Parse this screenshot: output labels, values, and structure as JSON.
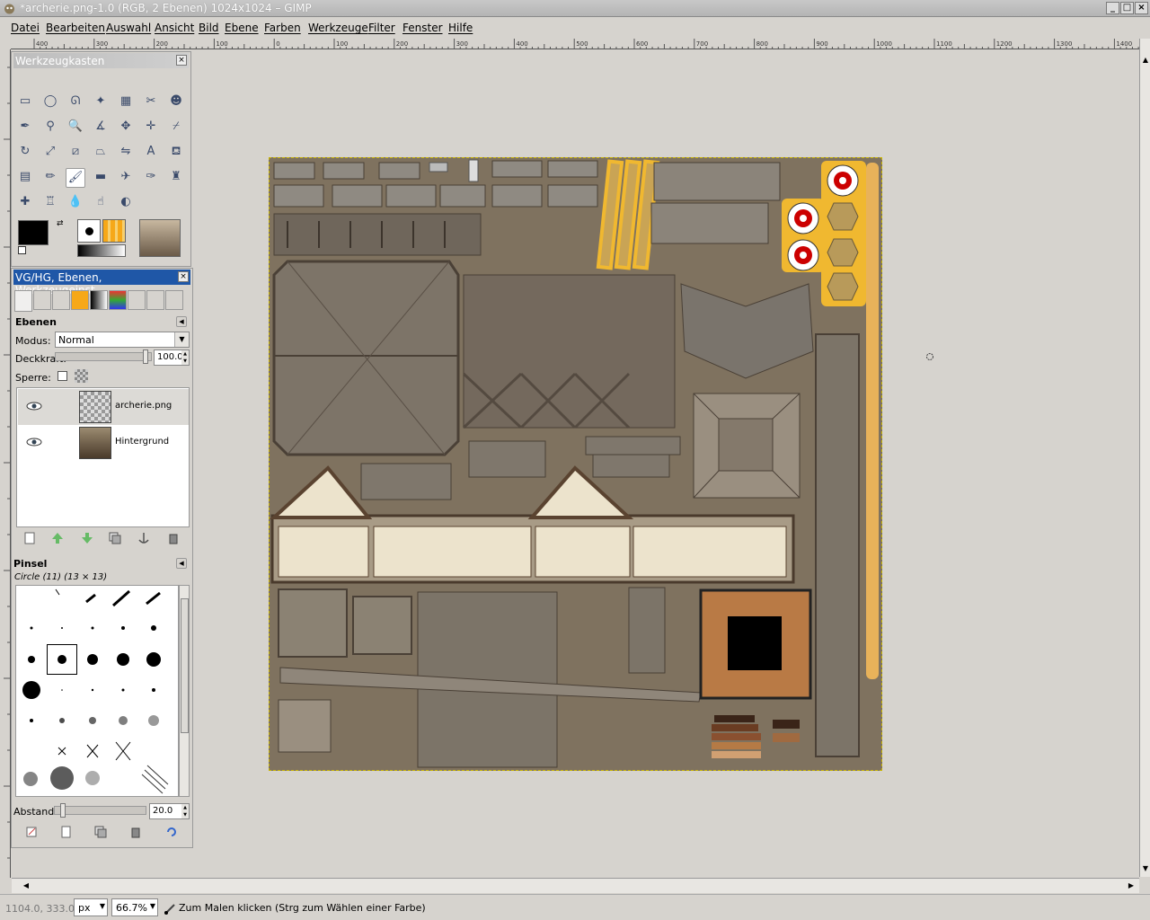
{
  "window": {
    "title": "*archerie.png-1.0 (RGB, 2 Ebenen) 1024x1024 – GIMP",
    "minimize": "_",
    "maximize": "□",
    "close": "×"
  },
  "menu": [
    "Datei",
    "Bearbeiten",
    "Auswahl",
    "Ansicht",
    "Bild",
    "Ebene",
    "Farben",
    "Werkzeuge",
    "Filter",
    "Fenster",
    "Hilfe"
  ],
  "ruler_labels": [
    "400",
    "300",
    "200",
    "100",
    "0",
    "100",
    "200",
    "300",
    "400",
    "500",
    "600",
    "700",
    "800",
    "900",
    "1000",
    "1100",
    "1200",
    "1300",
    "1400"
  ],
  "toolbox": {
    "title": "Werkzeugkasten",
    "tools": [
      "rect-select-icon",
      "ellipse-select-icon",
      "free-select-icon",
      "fuzzy-select-icon",
      "select-by-color-icon",
      "scissors-icon",
      "foreground-select-icon",
      "paths-icon",
      "color-picker-icon",
      "zoom-icon",
      "measure-icon",
      "move-icon",
      "align-icon",
      "crop-icon",
      "rotate-icon",
      "scale-icon",
      "shear-icon",
      "perspective-icon",
      "flip-icon",
      "text-icon",
      "bucket-fill-icon",
      "blend-icon",
      "pencil-icon",
      "paintbrush-icon",
      "eraser-icon",
      "airbrush-icon",
      "ink-icon",
      "clone-icon",
      "heal-icon",
      "perspective-clone-icon",
      "blur-icon",
      "smudge-icon",
      "dodge-burn-icon"
    ],
    "selected_tool": "paintbrush-icon",
    "fg_color": "#000000",
    "bg_color": "#ffffff"
  },
  "dock": {
    "title": "VG/HG, Ebenen, Werkzeugeinst…",
    "layers": {
      "heading": "Ebenen",
      "mode_label": "Modus:",
      "mode_value": "Normal",
      "opacity_label": "Deckkraft:",
      "opacity_value": "100.0",
      "lock_label": "Sperre:",
      "items": [
        {
          "name": "archerie.png",
          "visible": true
        },
        {
          "name": "Hintergrund",
          "visible": true,
          "selected": true
        }
      ]
    },
    "brushes": {
      "heading": "Pinsel",
      "current": "Circle (11) (13 × 13)",
      "spacing_label": "Abstand:",
      "spacing_value": "20.0"
    }
  },
  "statusbar": {
    "coords": "1104.0, 333.0",
    "unit": "px",
    "zoom": "66.7%",
    "hint": "Zum Malen klicken (Strg zum Wählen einer Farbe)"
  },
  "colors": {
    "desktop": "#d6d3ce",
    "active_title": "#1f57a7",
    "texture_bg": "#7f725f",
    "target_yellow": "#f0b830"
  }
}
